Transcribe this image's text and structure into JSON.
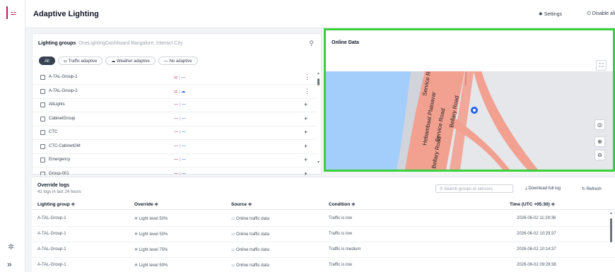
{
  "app": {
    "title": "Adaptive Lighting",
    "settings_label": "Settings",
    "disable_label": "Disable all"
  },
  "groups_panel": {
    "title": "Lighting groups",
    "subtitle": "OneLightingDashboard Bangalore, Interact City",
    "filters": [
      {
        "label": "All",
        "active": true
      },
      {
        "label": "Traffic adaptive",
        "icon": "traffic-light-icon"
      },
      {
        "label": "Weather adaptive",
        "icon": "cloud-icon"
      },
      {
        "label": "No adaptive",
        "icon": "dash-icon"
      }
    ],
    "items": [
      {
        "name": "A-TAL-Group-1",
        "traffic": "⚍",
        "weather": "—",
        "action": "⋮"
      },
      {
        "name": "A-TAL-Group-2",
        "traffic": "⚍",
        "weather": "☁",
        "action": "⋮"
      },
      {
        "name": "AllLights",
        "traffic": "—",
        "weather": "—",
        "action": "+"
      },
      {
        "name": "CabinetGroup",
        "traffic": "—",
        "weather": "—",
        "action": "+"
      },
      {
        "name": "CTC",
        "traffic": "—",
        "weather": "—",
        "action": "+"
      },
      {
        "name": "CTC-CabinetGM",
        "traffic": "—",
        "weather": "—",
        "action": "+"
      },
      {
        "name": "Emergency",
        "traffic": "—",
        "weather": "—",
        "action": "+"
      },
      {
        "name": "Group-001",
        "traffic": "—",
        "weather": "—",
        "action": "+"
      }
    ]
  },
  "online_data": {
    "title": "Online Data",
    "road_labels": [
      "Service Ro",
      "Hebambaal Plaioavar",
      "Service Road",
      "Bellary Road",
      "Bellary Road"
    ]
  },
  "logs": {
    "title": "Override logs",
    "subtitle": "41 logs in last 24 hours",
    "search_placeholder": "Search groups or sensors",
    "download_label": "Download full log",
    "refresh_label": "Refresh",
    "columns": [
      "Lighting group ≑",
      "Override ≑",
      "Source ≑",
      "Condition ≑",
      "Time (UTC +05:30) ≑"
    ],
    "rows": [
      [
        "A-TAL-Group-1",
        "Light level 50%",
        "Online traffic data",
        "Traffic is low",
        "2026-06-02 11:29:36"
      ],
      [
        "A-TAL-Group-1",
        "Light level 50%",
        "Online traffic data",
        "Traffic is low",
        "2026-06-02 10:29:37"
      ],
      [
        "A-TAL-Group-1",
        "Light level 75%",
        "Online traffic data",
        "Traffic is medium",
        "2026-06-02 10:14:37"
      ],
      [
        "A-TAL-Group-1",
        "Light level 50%",
        "Online traffic data",
        "Traffic is low",
        "2026-06-02 09:29:38"
      ]
    ]
  },
  "colors": {
    "accent": "#c2185b",
    "highlight": "#3ad13a",
    "road": "#f2a090",
    "water": "#a3cdfb"
  }
}
